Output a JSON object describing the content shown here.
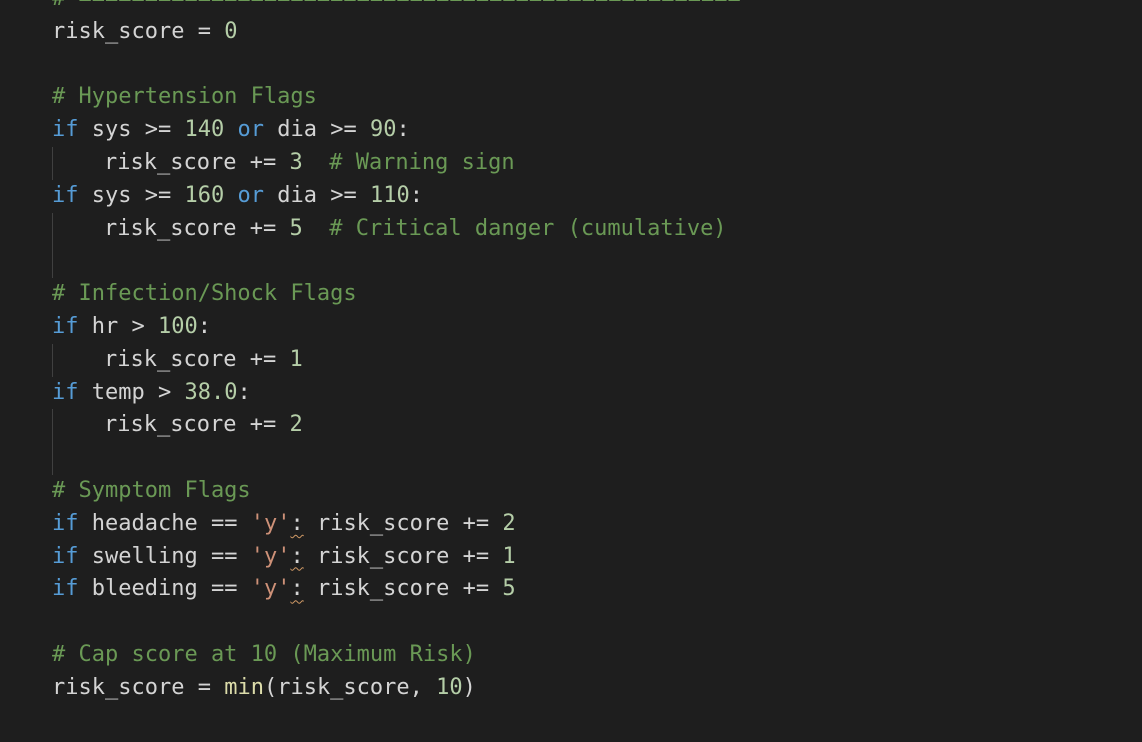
{
  "editor": {
    "lines": [
      {
        "tokens": [
          [
            "comment",
            "# =================================================="
          ]
        ]
      },
      {
        "tokens": [
          [
            "var",
            "risk_score"
          ],
          [
            "op",
            " = "
          ],
          [
            "num",
            "0"
          ]
        ]
      },
      {
        "tokens": []
      },
      {
        "tokens": [
          [
            "comment",
            "# Hypertension Flags"
          ]
        ]
      },
      {
        "tokens": [
          [
            "kw",
            "if"
          ],
          [
            "var",
            " sys "
          ],
          [
            "op",
            ">="
          ],
          [
            "var",
            " "
          ],
          [
            "num",
            "140"
          ],
          [
            "var",
            " "
          ],
          [
            "kw",
            "or"
          ],
          [
            "var",
            " dia "
          ],
          [
            "op",
            ">="
          ],
          [
            "var",
            " "
          ],
          [
            "num",
            "90"
          ],
          [
            "punc",
            ":"
          ]
        ]
      },
      {
        "indent": true,
        "tokens": [
          [
            "var",
            "risk_score "
          ],
          [
            "op",
            "+="
          ],
          [
            "var",
            " "
          ],
          [
            "num",
            "3"
          ],
          [
            "var",
            "  "
          ],
          [
            "comment",
            "# Warning sign"
          ]
        ]
      },
      {
        "tokens": [
          [
            "kw",
            "if"
          ],
          [
            "var",
            " sys "
          ],
          [
            "op",
            ">="
          ],
          [
            "var",
            " "
          ],
          [
            "num",
            "160"
          ],
          [
            "var",
            " "
          ],
          [
            "kw",
            "or"
          ],
          [
            "var",
            " dia "
          ],
          [
            "op",
            ">="
          ],
          [
            "var",
            " "
          ],
          [
            "num",
            "110"
          ],
          [
            "punc",
            ":"
          ]
        ]
      },
      {
        "indent": true,
        "tokens": [
          [
            "var",
            "risk_score "
          ],
          [
            "op",
            "+="
          ],
          [
            "var",
            " "
          ],
          [
            "num",
            "5"
          ],
          [
            "var",
            "  "
          ],
          [
            "comment",
            "# Critical danger (cumulative)"
          ]
        ]
      },
      {
        "indent": true,
        "tokens": []
      },
      {
        "tokens": [
          [
            "comment",
            "# Infection/Shock Flags"
          ]
        ]
      },
      {
        "tokens": [
          [
            "kw",
            "if"
          ],
          [
            "var",
            " hr "
          ],
          [
            "op",
            ">"
          ],
          [
            "var",
            " "
          ],
          [
            "num",
            "100"
          ],
          [
            "punc",
            ":"
          ]
        ]
      },
      {
        "indent": true,
        "tokens": [
          [
            "var",
            "risk_score "
          ],
          [
            "op",
            "+="
          ],
          [
            "var",
            " "
          ],
          [
            "num",
            "1"
          ]
        ]
      },
      {
        "tokens": [
          [
            "kw",
            "if"
          ],
          [
            "var",
            " temp "
          ],
          [
            "op",
            ">"
          ],
          [
            "var",
            " "
          ],
          [
            "num",
            "38.0"
          ],
          [
            "punc",
            ":"
          ]
        ]
      },
      {
        "indent": true,
        "tokens": [
          [
            "var",
            "risk_score "
          ],
          [
            "op",
            "+="
          ],
          [
            "var",
            " "
          ],
          [
            "num",
            "2"
          ]
        ]
      },
      {
        "indent": true,
        "tokens": []
      },
      {
        "tokens": [
          [
            "comment",
            "# Symptom Flags"
          ]
        ]
      },
      {
        "tokens": [
          [
            "kw",
            "if"
          ],
          [
            "var",
            " headache "
          ],
          [
            "op",
            "=="
          ],
          [
            "var",
            " "
          ],
          [
            "str",
            "'y'"
          ],
          [
            "squiggle",
            ":"
          ],
          [
            "var",
            " risk_score "
          ],
          [
            "op",
            "+="
          ],
          [
            "var",
            " "
          ],
          [
            "num",
            "2"
          ]
        ]
      },
      {
        "tokens": [
          [
            "kw",
            "if"
          ],
          [
            "var",
            " swelling "
          ],
          [
            "op",
            "=="
          ],
          [
            "var",
            " "
          ],
          [
            "str",
            "'y'"
          ],
          [
            "squiggle",
            ":"
          ],
          [
            "var",
            " risk_score "
          ],
          [
            "op",
            "+="
          ],
          [
            "var",
            " "
          ],
          [
            "num",
            "1"
          ]
        ]
      },
      {
        "tokens": [
          [
            "kw",
            "if"
          ],
          [
            "var",
            " bleeding "
          ],
          [
            "op",
            "=="
          ],
          [
            "var",
            " "
          ],
          [
            "str",
            "'y'"
          ],
          [
            "squiggle",
            ":"
          ],
          [
            "var",
            " risk_score "
          ],
          [
            "op",
            "+="
          ],
          [
            "var",
            " "
          ],
          [
            "num",
            "5"
          ]
        ]
      },
      {
        "tokens": []
      },
      {
        "tokens": [
          [
            "comment",
            "# Cap score at 10 (Maximum Risk)"
          ]
        ]
      },
      {
        "tokens": [
          [
            "var",
            "risk_score"
          ],
          [
            "op",
            " = "
          ],
          [
            "fn",
            "min"
          ],
          [
            "punc",
            "("
          ],
          [
            "var",
            "risk_score, "
          ],
          [
            "num",
            "10"
          ],
          [
            "punc",
            ")"
          ]
        ]
      }
    ]
  },
  "colors": {
    "background": "#1e1e1e",
    "comment": "#6a9955",
    "keyword": "#569cd6",
    "number": "#b5cea8",
    "string": "#ce9178",
    "function": "#dcdcaa",
    "text": "#d4d4d4"
  }
}
